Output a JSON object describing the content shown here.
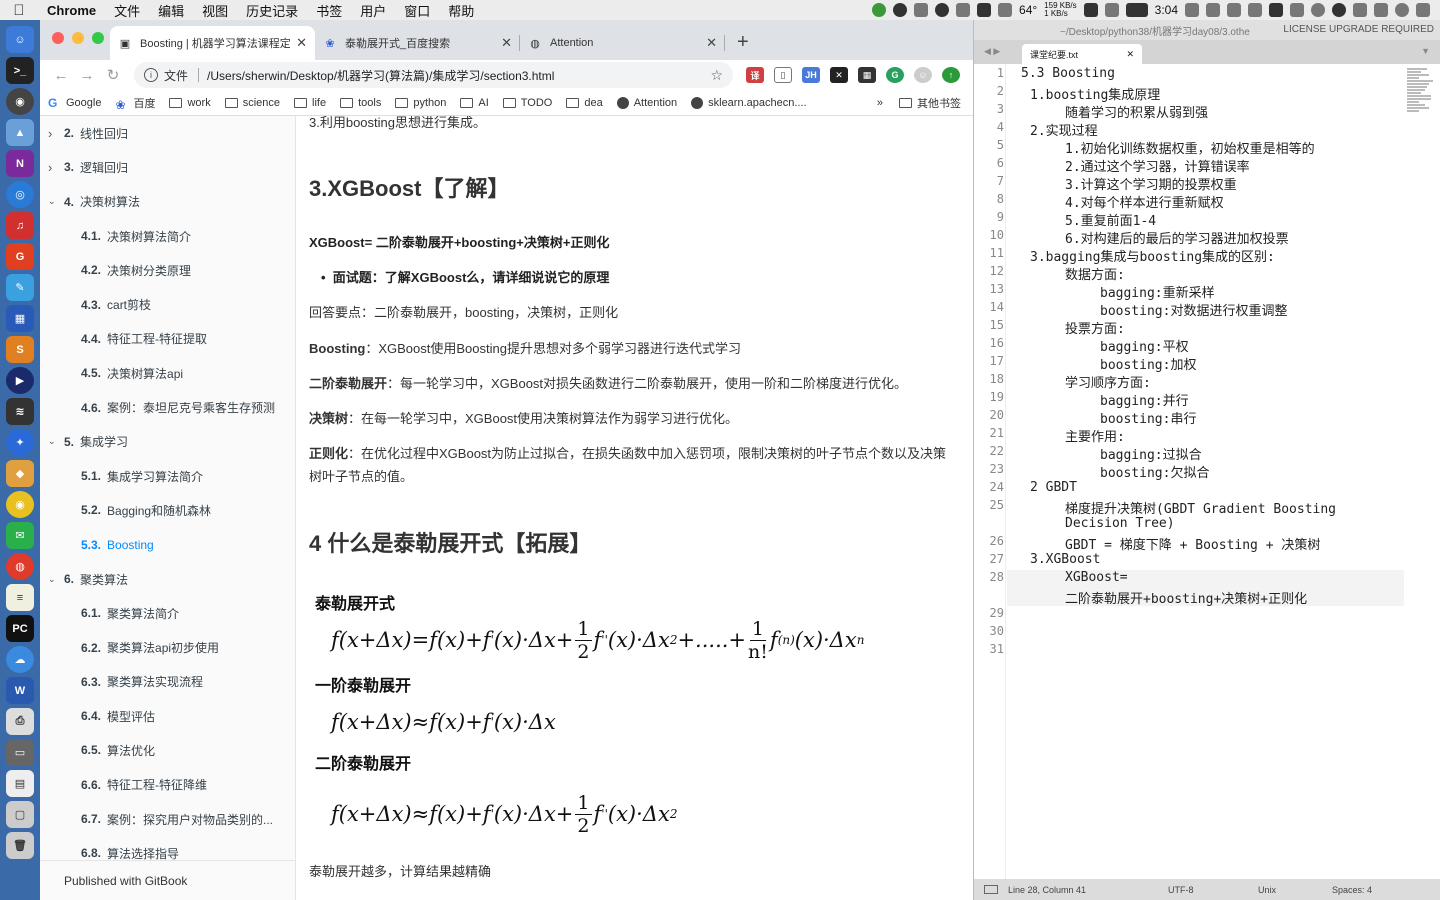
{
  "menubar": {
    "app": "Chrome",
    "items": [
      "文件",
      "编辑",
      "视图",
      "历史记录",
      "书签",
      "用户",
      "窗口",
      "帮助"
    ],
    "temperature": "64°",
    "net_up": "159 KB/s",
    "net_down": "1 KB/s",
    "time": "3:04"
  },
  "browser": {
    "tabs": [
      {
        "title": "Boosting | 机器学习算法课程定",
        "icon": "book-icon",
        "active": true
      },
      {
        "title": "泰勒展开式_百度搜索",
        "icon": "baidu-paw-icon",
        "active": false
      },
      {
        "title": "Attention",
        "icon": "globe-icon",
        "active": false
      }
    ],
    "scheme_label": "文件",
    "url": "/Users/sherwin/Desktop/机器学习(算法篇)/集成学习/section3.html",
    "bookmarks": [
      "Google",
      "百度",
      "work",
      "science",
      "life",
      "tools",
      "python",
      "AI",
      "TODO",
      "dea",
      "Attention",
      "sklearn.apachecn...."
    ],
    "bookmarks_more": "»",
    "other_bookmarks": "其他书签"
  },
  "sidebar": {
    "items": [
      {
        "num": "2.",
        "label": "线性回归",
        "level": 1,
        "expanded": false
      },
      {
        "num": "3.",
        "label": "逻辑回归",
        "level": 1,
        "expanded": false
      },
      {
        "num": "4.",
        "label": "决策树算法",
        "level": 1,
        "expanded": true
      },
      {
        "num": "4.1.",
        "label": "决策树算法简介",
        "level": 2
      },
      {
        "num": "4.2.",
        "label": "决策树分类原理",
        "level": 2
      },
      {
        "num": "4.3.",
        "label": "cart剪枝",
        "level": 2
      },
      {
        "num": "4.4.",
        "label": "特征工程-特征提取",
        "level": 2
      },
      {
        "num": "4.5.",
        "label": "决策树算法api",
        "level": 2
      },
      {
        "num": "4.6.",
        "label": "案例：泰坦尼克号乘客生存预测",
        "level": 2
      },
      {
        "num": "5.",
        "label": "集成学习",
        "level": 1,
        "expanded": true
      },
      {
        "num": "5.1.",
        "label": "集成学习算法简介",
        "level": 2
      },
      {
        "num": "5.2.",
        "label": "Bagging和随机森林",
        "level": 2
      },
      {
        "num": "5.3.",
        "label": "Boosting",
        "level": 2,
        "active": true
      },
      {
        "num": "6.",
        "label": "聚类算法",
        "level": 1,
        "expanded": true
      },
      {
        "num": "6.1.",
        "label": "聚类算法简介",
        "level": 2
      },
      {
        "num": "6.2.",
        "label": "聚类算法api初步使用",
        "level": 2
      },
      {
        "num": "6.3.",
        "label": "聚类算法实现流程",
        "level": 2
      },
      {
        "num": "6.4.",
        "label": "模型评估",
        "level": 2
      },
      {
        "num": "6.5.",
        "label": "算法优化",
        "level": 2
      },
      {
        "num": "6.6.",
        "label": "特征工程-特征降维",
        "level": 2
      },
      {
        "num": "6.7.",
        "label": "案例：探究用户对物品类别的...",
        "level": 2
      },
      {
        "num": "6.8.",
        "label": "算法选择指导",
        "level": 2
      }
    ],
    "footer": "Published with GitBook"
  },
  "article": {
    "top_line": "3.利用boosting思想进行集成。",
    "h_xgboost": "3.XGBoost【了解】",
    "xgb_def": "XGBoost= 二阶泰勒展开+boosting+决策树+正则化",
    "bullet": "面试题：了解XGBoost么，请详细说说它的原理",
    "answer_points": "回答要点：二阶泰勒展开，boosting，决策树，正则化",
    "p_boosting_label": "Boosting",
    "p_boosting_text": "：XGBoost使用Boosting提升思想对多个弱学习器进行迭代式学习",
    "p_taylor_label": "二阶泰勒展开",
    "p_taylor_text": "：每一轮学习中，XGBoost对损失函数进行二阶泰勒展开，使用一阶和二阶梯度进行优化。",
    "p_tree_label": "决策树",
    "p_tree_text": "：在每一轮学习中，XGBoost使用决策树算法作为弱学习进行优化。",
    "p_reg_label": "正则化",
    "p_reg_text": "：在优化过程中XGBoost为防止过拟合，在损失函数中加入惩罚项，限制决策树的叶子节点个数以及决策树叶子节点的值。",
    "h_taylor": "4 什么是泰勒展开式【拓展】",
    "formula_title_1": "泰勒展开式",
    "formula_title_2": "一阶泰勒展开",
    "formula_title_3": "二阶泰勒展开",
    "bottom_line": "泰勒展开越多，计算结果越精确"
  },
  "editor": {
    "path": "~/Desktop/python38/机器学习day08/3.othe",
    "license": "LICENSE UPGRADE REQUIRED",
    "tab": "课堂纪要.txt",
    "lines": [
      {
        "n": "1",
        "text": "5.3 Boosting",
        "indent": 0
      },
      {
        "n": "2",
        "text": "1.boosting集成原理",
        "indent": 1
      },
      {
        "n": "3",
        "text": "随着学习的积累从弱到强",
        "indent": 2
      },
      {
        "n": "4",
        "text": "2.实现过程",
        "indent": 1
      },
      {
        "n": "5",
        "text": "1.初始化训练数据权重，初始权重是相等的",
        "indent": 2
      },
      {
        "n": "6",
        "text": "2.通过这个学习器，计算错误率",
        "indent": 2
      },
      {
        "n": "7",
        "text": "3.计算这个学习期的投票权重",
        "indent": 2
      },
      {
        "n": "8",
        "text": "4.对每个样本进行重新赋权",
        "indent": 2
      },
      {
        "n": "9",
        "text": "5.重复前面1-4",
        "indent": 2
      },
      {
        "n": "10",
        "text": "6.对构建后的最后的学习器进加权投票",
        "indent": 2
      },
      {
        "n": "11",
        "text": "3.bagging集成与boosting集成的区别:",
        "indent": 1
      },
      {
        "n": "12",
        "text": "数据方面:",
        "indent": 2
      },
      {
        "n": "13",
        "text": "bagging:重新采样",
        "indent": 3
      },
      {
        "n": "14",
        "text": "boosting:对数据进行权重调整",
        "indent": 3
      },
      {
        "n": "15",
        "text": "投票方面:",
        "indent": 2
      },
      {
        "n": "16",
        "text": "bagging:平权",
        "indent": 3
      },
      {
        "n": "17",
        "text": "boosting:加权",
        "indent": 3
      },
      {
        "n": "18",
        "text": "学习顺序方面:",
        "indent": 2
      },
      {
        "n": "19",
        "text": "bagging:并行",
        "indent": 3
      },
      {
        "n": "20",
        "text": "boosting:串行",
        "indent": 3
      },
      {
        "n": "21",
        "text": "主要作用:",
        "indent": 2
      },
      {
        "n": "22",
        "text": "bagging:过拟合",
        "indent": 3
      },
      {
        "n": "23",
        "text": "boosting:欠拟合",
        "indent": 3
      },
      {
        "n": "24",
        "text": "2 GBDT",
        "indent": 1
      },
      {
        "n": "25",
        "text": "梯度提升决策树(GBDT Gradient Boosting",
        "indent": 2,
        "wrap": "Decision Tree)"
      },
      {
        "n": "26",
        "text": "GBDT = 梯度下降 + Boosting + 决策树",
        "indent": 2
      },
      {
        "n": "27",
        "text": "3.XGBoost",
        "indent": 1
      },
      {
        "n": "28",
        "text": "XGBoost=",
        "indent": 2,
        "wrap": "二阶泰勒展开+boosting+决策树+正则化",
        "current": true
      },
      {
        "n": "29",
        "text": "",
        "indent": 0
      },
      {
        "n": "30",
        "text": "",
        "indent": 0
      },
      {
        "n": "31",
        "text": "",
        "indent": 0
      }
    ],
    "status_pos": "Line 28, Column 41",
    "status_enc": "UTF-8",
    "status_eol": "Unix",
    "status_indent": "Spaces: 4"
  }
}
